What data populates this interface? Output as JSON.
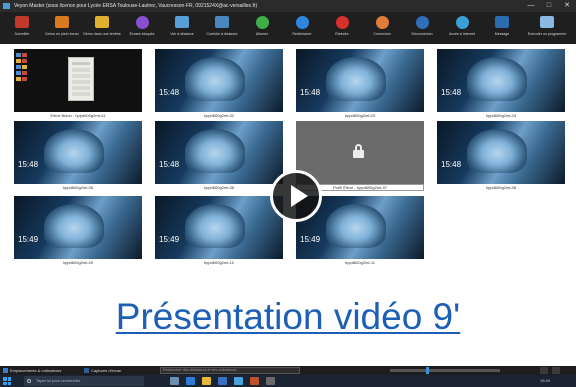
{
  "window": {
    "title": "Veyon Master (sous licence pour Lycée ERSA Toulouse-Lautrec, Vaucresson-FR, 0921524X@ac-versailles.fr)",
    "controls": {
      "minimize": "—",
      "maximize": "□",
      "close": "✕"
    }
  },
  "toolbar": {
    "buttons": [
      {
        "label": "Surveiller",
        "icon": "monitor-icon",
        "color": "#c0392b"
      },
      {
        "label": "Démo en plein écran",
        "icon": "fullscreen-demo-icon",
        "color": "#d97a1e"
      },
      {
        "label": "Démo dans une fenêtre",
        "icon": "window-demo-icon",
        "color": "#e0b030"
      },
      {
        "label": "Écrans bloqués",
        "icon": "lock-screen-icon",
        "color": "#8a4fcf"
      },
      {
        "label": "Voir à distance",
        "icon": "remote-view-icon",
        "color": "#5aa0d8"
      },
      {
        "label": "Contrôle à distance",
        "icon": "remote-control-icon",
        "color": "#4a86c0"
      },
      {
        "label": "Allumer",
        "icon": "power-on-icon",
        "color": "#3fae49"
      },
      {
        "label": "Redémarrer",
        "icon": "reboot-icon",
        "color": "#2e86de"
      },
      {
        "label": "Éteindre",
        "icon": "power-off-icon",
        "color": "#d9302c"
      },
      {
        "label": "Connexion",
        "icon": "login-icon",
        "color": "#e07b39"
      },
      {
        "label": "Déconnexion",
        "icon": "logout-icon",
        "color": "#2f6fb8"
      },
      {
        "label": "Accès à Internet",
        "icon": "globe-icon",
        "color": "#3aa0d8"
      },
      {
        "label": "Message",
        "icon": "message-icon",
        "color": "#2b6cb0"
      },
      {
        "label": "Exécuter un programme",
        "icon": "run-program-icon",
        "color": "#8ab8e0"
      }
    ]
  },
  "tiles": [
    {
      "caption": "Elève Bidon - hppd600g2mt-01",
      "clock": "",
      "kind": "desktop"
    },
    {
      "caption": "hppd600g2mt-02",
      "clock": "15:48",
      "kind": "lockscreen"
    },
    {
      "caption": "hppd600g2mt-03",
      "clock": "15:48",
      "kind": "lockscreen"
    },
    {
      "caption": "hppd600g2mt-04",
      "clock": "15:48",
      "kind": "lockscreen"
    },
    {
      "caption": "hppd600g2mt-05",
      "clock": "15:48",
      "kind": "lockscreen"
    },
    {
      "caption": "hppd600g2mt-06",
      "clock": "15:48",
      "kind": "lockscreen"
    },
    {
      "caption": "Profil Élève - hppd600g2mt-07",
      "clock": "",
      "kind": "locked"
    },
    {
      "caption": "hppd600g2mt-08",
      "clock": "15:48",
      "kind": "lockscreen"
    },
    {
      "caption": "hppd600g2mt-09",
      "clock": "15:49",
      "kind": "lockscreen"
    },
    {
      "caption": "hppd600g2mt-10",
      "clock": "15:49",
      "kind": "lockscreen"
    },
    {
      "caption": "hppd600g2mt-11",
      "clock": "15:49",
      "kind": "lockscreen"
    }
  ],
  "video": {
    "title": "Présentation vidéo 9'",
    "play_icon": "play-icon"
  },
  "statusbar": {
    "locations_label": "Emplacements & ordinateurs",
    "screenshots_label": "Captures d'écran",
    "filter_placeholder": "Rechercher des utilisateurs et des ordinateurs"
  },
  "taskbar": {
    "search_placeholder": "Taper ici pour rechercher",
    "time": "15:49"
  }
}
